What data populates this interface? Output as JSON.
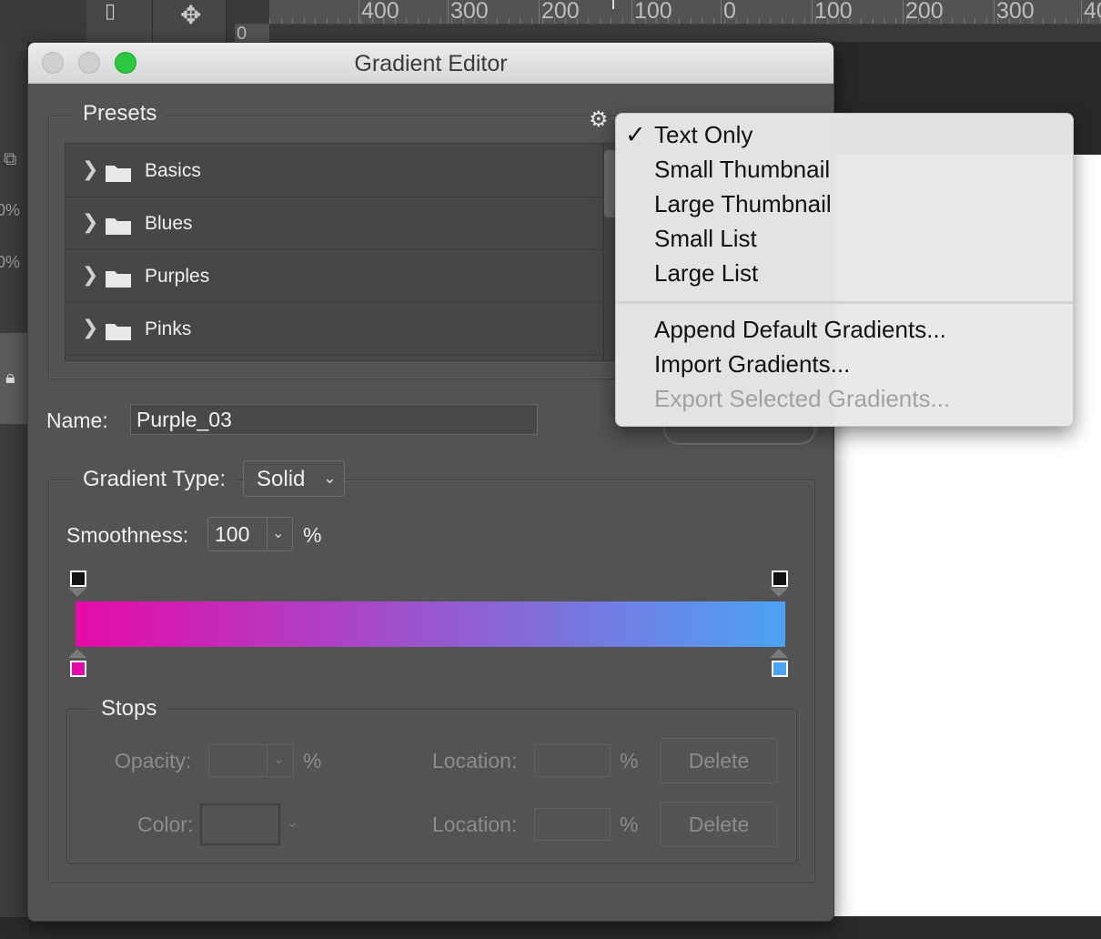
{
  "dialog": {
    "title": "Gradient Editor",
    "presets": {
      "label": "Presets",
      "folders": [
        "Basics",
        "Blues",
        "Purples",
        "Pinks"
      ]
    },
    "name": {
      "label": "Name:",
      "value": "Purple_03"
    },
    "gradient_type": {
      "label": "Gradient Type:",
      "value": "Solid"
    },
    "smoothness": {
      "label": "Smoothness:",
      "value": "100",
      "unit": "%"
    },
    "gradient": {
      "start_color": "#E60AA8",
      "end_color": "#4BA3F5"
    },
    "stops": {
      "label": "Stops",
      "opacity_label": "Opacity:",
      "color_label": "Color:",
      "location_label": "Location:",
      "percent": "%",
      "delete_label": "Delete"
    }
  },
  "menu": {
    "checkmark": "✓",
    "view_items": [
      "Text Only",
      "Small Thumbnail",
      "Large Thumbnail",
      "Small List",
      "Large List"
    ],
    "selected": "Text Only",
    "action_items": [
      "Append Default Gradients...",
      "Import Gradients...",
      "Export Selected Gradients..."
    ],
    "disabled": "Export Selected Gradients..."
  },
  "ruler": {
    "labels": [
      "400",
      "300",
      "200",
      "100",
      "0",
      "100",
      "200",
      "300",
      "40"
    ],
    "side_label": "0"
  },
  "left_panel": {
    "opacity_fields": [
      "0%",
      "0%"
    ]
  },
  "colors": {
    "accent_green": "#2BC840",
    "dialog_bg": "#535353",
    "menu_bg": "#E8E8E8"
  }
}
